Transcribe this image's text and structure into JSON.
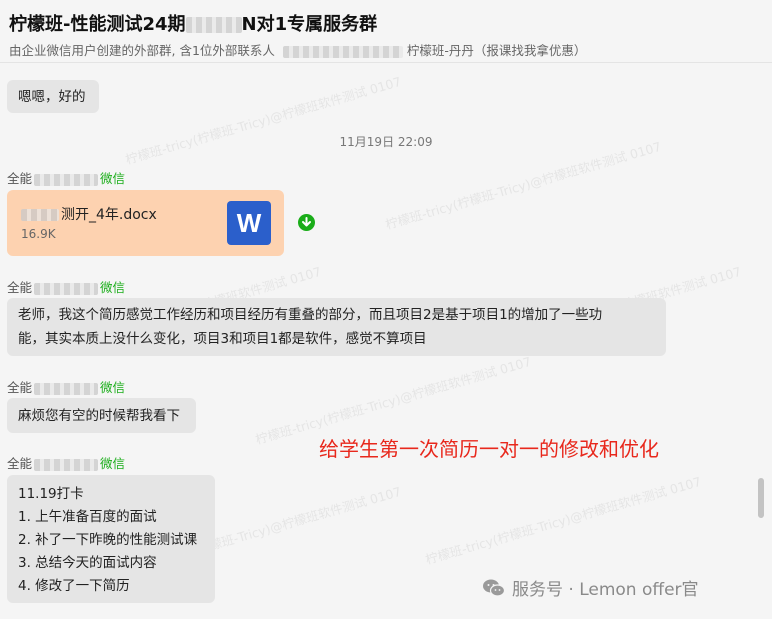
{
  "header": {
    "title_part1": "柠檬班-性能测试24期",
    "title_part2": "N对1专属服务群",
    "subtitle_part1": "由企业微信用户创建的外部群, 含1位外部联系人",
    "subtitle_part2": "柠檬班-丹丹（报课找我拿优惠）"
  },
  "messages": {
    "msg1": "嗯嗯，好的",
    "timestamp": "11月19日 22:09",
    "sender_prefix": "全能",
    "sender_tag": "微信",
    "file_name_suffix": "测开_4年.docx",
    "file_size": "16.9K",
    "file_icon": "W",
    "msg3_line1": "老师，我这个简历感觉工作经历和项目经历有重叠的部分，而且项目2是基于项目1的增加了一些功",
    "msg3_line2": "能，其实本质上没什么变化，项目3和项目1都是软件，感觉不算项目",
    "msg4": "麻烦您有空的时候帮我看下",
    "msg5_lines": [
      "11.19打卡",
      "1. 上午准备百度的面试",
      "2. 补了一下昨晚的性能测试课",
      "3. 总结今天的面试内容",
      "4. 修改了一下简历"
    ]
  },
  "annotation": "给学生第一次简历一对一的修改和优化",
  "watermark_text": "柠檬班-tricy(柠檬班-Tricy)@柠檬班软件测试 0107",
  "brand": "服务号 · Lemon offer官",
  "colors": {
    "wechat_green": "#1aad19",
    "file_bubble": "#fdd2b0",
    "word_blue": "#2b5fcb",
    "annotation_red": "#e8281c",
    "bubble_gray": "#e5e5e5"
  },
  "icons": [
    "word-doc-icon",
    "download-icon",
    "wechat-logo-icon"
  ]
}
